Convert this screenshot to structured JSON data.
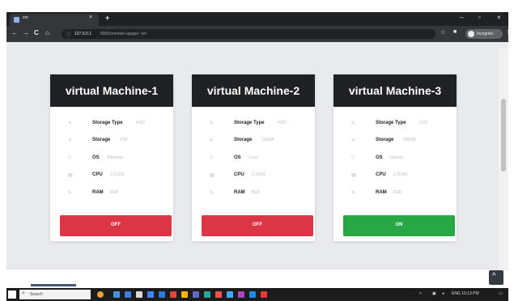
{
  "browser": {
    "tab_title": "cm",
    "tab_close": "×",
    "new_tab": "+",
    "window_controls": {
      "minimize": "–",
      "maximize": "▫",
      "close": "×"
    },
    "back": "←",
    "forward": "→",
    "reload": "C",
    "home": "⌂",
    "url_host": "127.0.0.1",
    "url_path": "8000/cmdeler-apage/ -set",
    "bookmark_icon": "star-icon",
    "profile_label": "Incognito"
  },
  "cards": [
    {
      "title": "virtual Machine-1",
      "specs": [
        {
          "label": "Storage Type",
          "value": "HDD",
          "icon": "wrench-icon"
        },
        {
          "label": "Storage",
          "value": "2TB",
          "icon": "pen-icon"
        },
        {
          "label": "OS",
          "value": "Windows",
          "icon": "square-icon"
        },
        {
          "label": "CPU",
          "value": "2.2GHZ",
          "icon": "chip-icon"
        },
        {
          "label": "RAM",
          "value": "8GB",
          "icon": "wrench-icon"
        }
      ],
      "button": "OFF",
      "status": "off"
    },
    {
      "title": "virtual Machine-2",
      "specs": [
        {
          "label": "Storage Type",
          "value": "HDD",
          "icon": "wrench-icon"
        },
        {
          "label": "Storage",
          "value": "128GB",
          "icon": "pen-icon"
        },
        {
          "label": "OS",
          "value": "Linux",
          "icon": "square-icon"
        },
        {
          "label": "CPU",
          "value": "2.2GHZ",
          "icon": "chip-icon"
        },
        {
          "label": "RAM",
          "value": "8GB",
          "icon": "wrench-icon"
        }
      ],
      "button": "OFF",
      "status": "off"
    },
    {
      "title": "virtual Machine-3",
      "specs": [
        {
          "label": "Storage Type",
          "value": "SSD",
          "icon": "wrench-icon"
        },
        {
          "label": "Storage",
          "value": "500GB",
          "icon": "pen-icon"
        },
        {
          "label": "OS",
          "value": "Ubuntu",
          "icon": "square-icon"
        },
        {
          "label": "CPU",
          "value": "2.2GHZ",
          "icon": "chip-icon"
        },
        {
          "label": "RAM",
          "value": "8GB",
          "icon": "wrench-icon"
        }
      ],
      "button": "ON",
      "status": "on"
    }
  ],
  "scroll_top_icon": "^",
  "taskbar": {
    "search_placeholder": "Search",
    "tray_time": "ENG  10:13 PM"
  },
  "colors": {
    "header": "#202124",
    "off_button": "#dc3545",
    "on_button": "#28a745"
  }
}
